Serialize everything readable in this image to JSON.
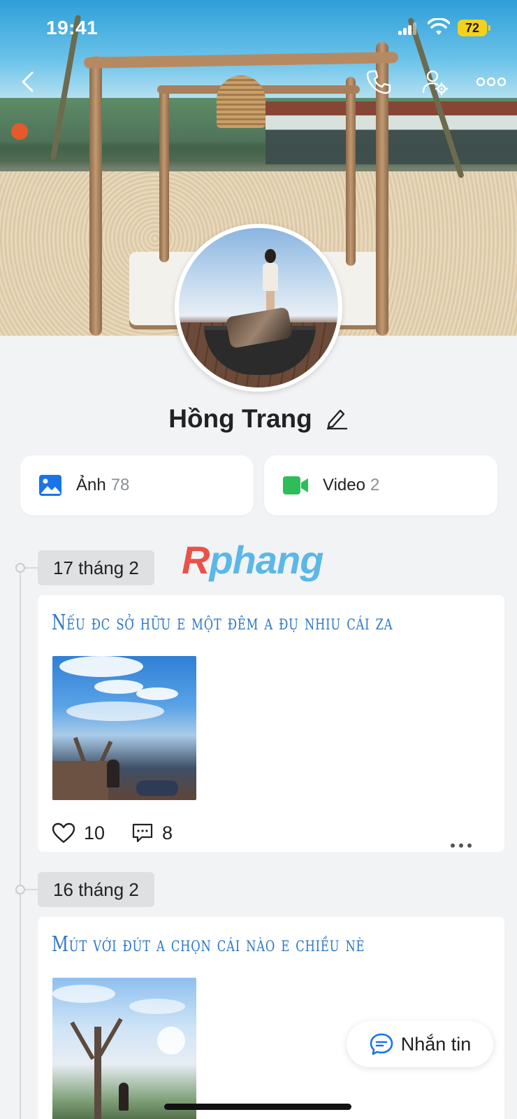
{
  "status_bar": {
    "time": "19:41",
    "battery": "72"
  },
  "profile": {
    "name": "Hồng Trang"
  },
  "media": [
    {
      "label": "Ảnh",
      "count": "78"
    },
    {
      "label": "Video",
      "count": "2"
    }
  ],
  "watermark": {
    "first": "R",
    "rest": "phang"
  },
  "posts": [
    {
      "date": "17 tháng 2",
      "text": "Nếu đc sở hữu e một đêm a đụ nhiu cái za",
      "likes": "10",
      "comments": "8"
    },
    {
      "date": "16 tháng 2",
      "text": "Mút với đút a chọn cái nào e chiều nè"
    }
  ],
  "message_button": {
    "label": "Nhắn tin"
  },
  "colors": {
    "accent": "#2d77c9",
    "video": "#2ebd59",
    "photo": "#1a73e8",
    "battery": "#f4d11a"
  },
  "icons": [
    "back-icon",
    "phone-icon",
    "user-settings-icon",
    "more-icon",
    "edit-icon",
    "photo-icon",
    "video-icon",
    "heart-icon",
    "comment-icon",
    "message-icon"
  ]
}
